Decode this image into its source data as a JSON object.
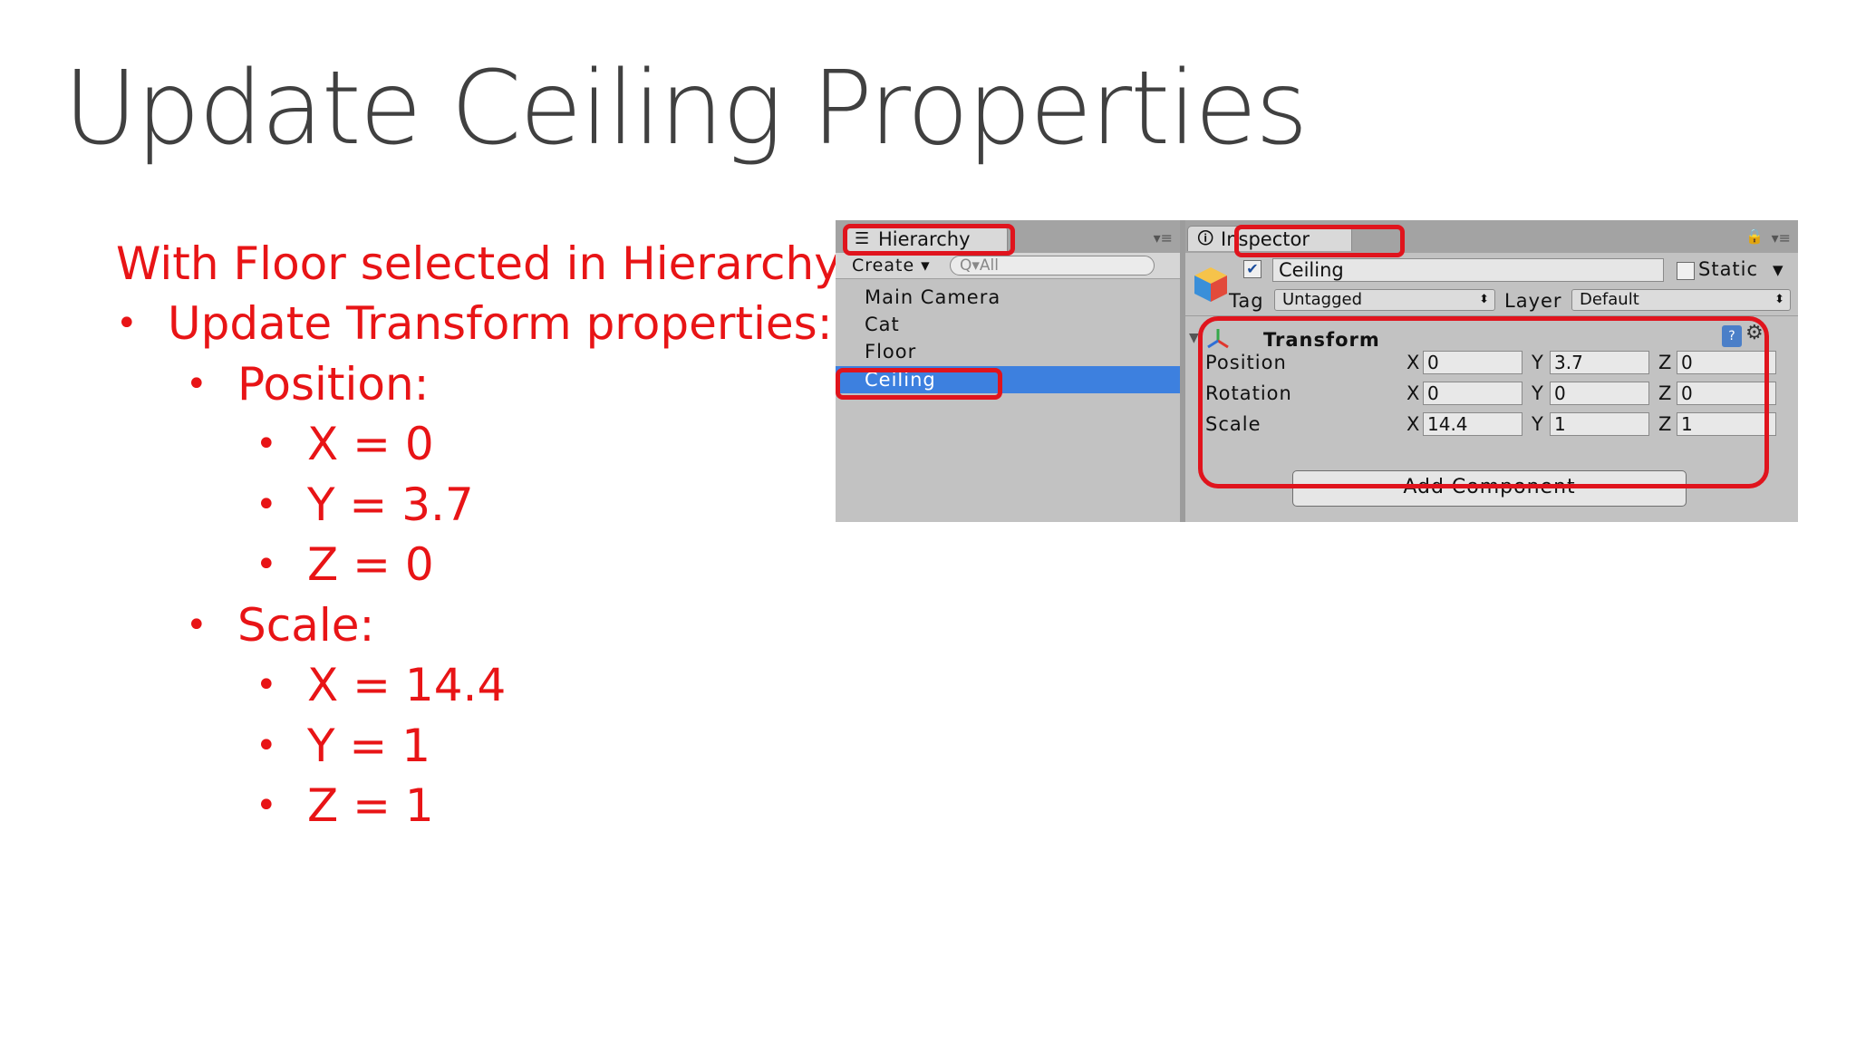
{
  "slide": {
    "title": "Update Ceiling Properties",
    "bullets": [
      {
        "level": 0,
        "text": "With Floor selected in Hierarchy:"
      },
      {
        "level": 1,
        "text": "Update Transform properties:"
      },
      {
        "level": 2,
        "text": "Position:"
      },
      {
        "level": 3,
        "text": "X = 0"
      },
      {
        "level": 3,
        "text": "Y = 3.7"
      },
      {
        "level": 3,
        "text": "Z = 0"
      },
      {
        "level": 2,
        "text": "Scale:"
      },
      {
        "level": 3,
        "text": "X = 14.4"
      },
      {
        "level": 3,
        "text": "Y = 1"
      },
      {
        "level": 3,
        "text": "Z = 1"
      }
    ],
    "bullet_glyph": "•",
    "accent_color": "#e81416"
  },
  "hierarchy": {
    "tab_label": "Hierarchy",
    "create_label": "Create ▾",
    "search_placeholder": "Q▾All",
    "items": [
      "Main Camera",
      "Cat",
      "Floor",
      "Ceiling"
    ],
    "selected": "Ceiling"
  },
  "inspector": {
    "tab_label": "Inspector",
    "object_name": "Ceiling",
    "active_checked": true,
    "static_label": "Static",
    "tag_label": "Tag",
    "tag_value": "Untagged",
    "layer_label": "Layer",
    "layer_value": "Default",
    "component_title": "Transform",
    "axis_labels": [
      "X",
      "Y",
      "Z"
    ],
    "rows": [
      {
        "label": "Position",
        "values": [
          "0",
          "3.7",
          "0"
        ]
      },
      {
        "label": "Rotation",
        "values": [
          "0",
          "0",
          "0"
        ]
      },
      {
        "label": "Scale",
        "values": [
          "14.4",
          "1",
          "1"
        ]
      }
    ],
    "add_component_label": "Add Component"
  },
  "icons": [
    "list-icon",
    "info-icon",
    "lock-icon",
    "panel-menu-icon",
    "gameobject-cube-icon",
    "transform-axes-icon",
    "help-book-icon",
    "gear-icon"
  ],
  "colors": {
    "selection": "#3d80df",
    "highlight_box": "#e0141d",
    "title": "#404040"
  }
}
